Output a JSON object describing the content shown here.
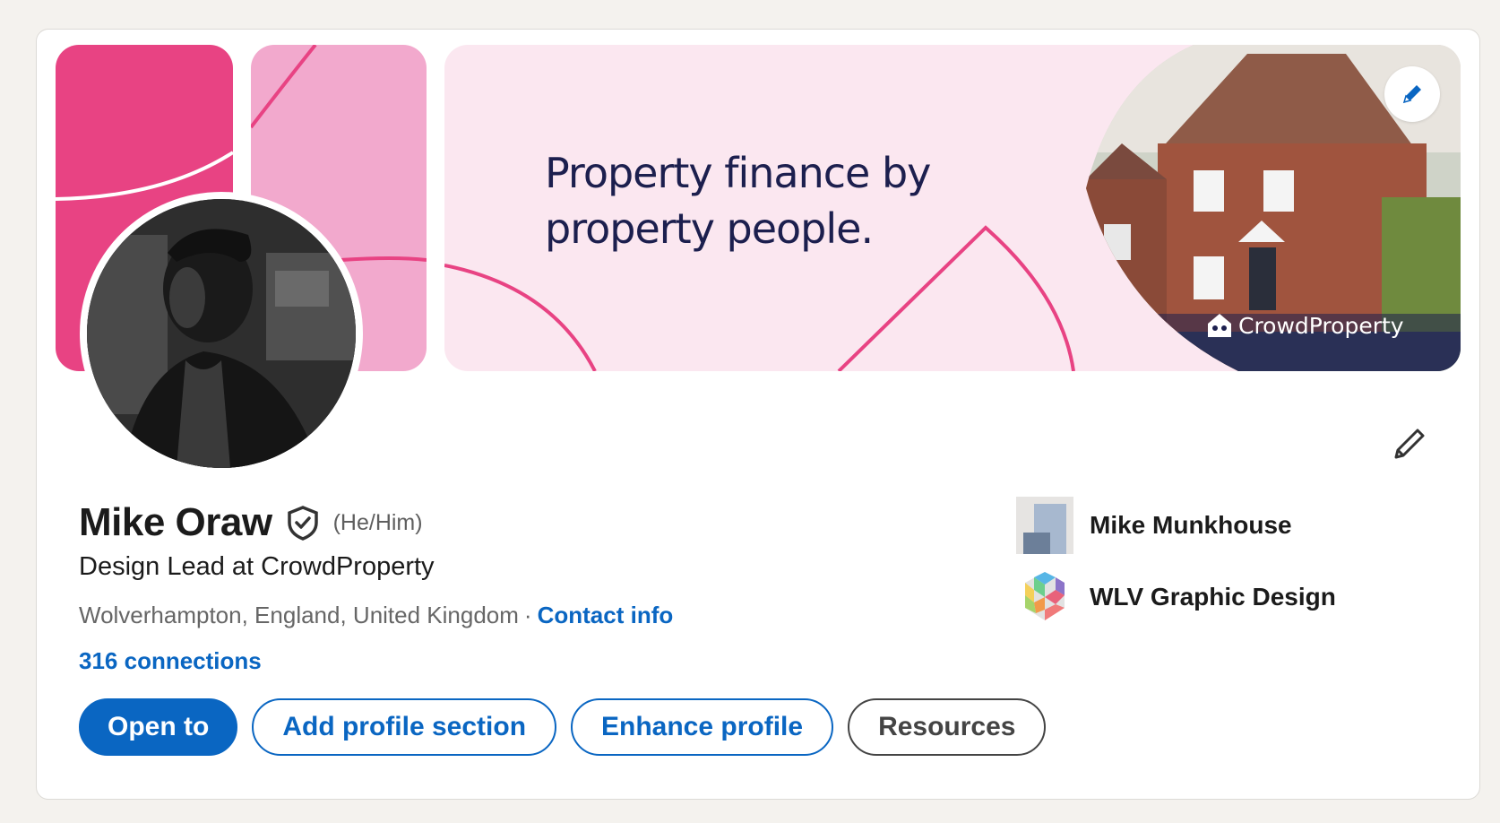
{
  "banner": {
    "tagline_line1": "Property finance by",
    "tagline_line2": "property people.",
    "brand_name": "CrowdProperty",
    "colors": {
      "pink_dark": "#e84383",
      "pink_light": "#f2a9cd",
      "pink_bg": "#fbe7f0",
      "navy": "#1c1f4e"
    },
    "edit_icon": "pencil-icon"
  },
  "profile": {
    "name": "Mike Oraw",
    "verified_icon": "shield-check-icon",
    "pronouns": "(He/Him)",
    "headline": "Design Lead at CrowdProperty",
    "location": "Wolverhampton, England, United Kingdom",
    "separator": "·",
    "contact_info": "Contact info",
    "connections": "316 connections",
    "edit_icon": "pencil-icon"
  },
  "actions": {
    "open_to": "Open to",
    "add_section": "Add profile section",
    "enhance": "Enhance profile",
    "resources": "Resources"
  },
  "sidebar": {
    "items": [
      {
        "label": "Mike Munkhouse",
        "icon": "company-logo"
      },
      {
        "label": "WLV Graphic Design",
        "icon": "school-logo"
      }
    ]
  },
  "colors": {
    "accent": "#0a66c2",
    "text": "#1b1b1b",
    "muted": "#666666"
  }
}
